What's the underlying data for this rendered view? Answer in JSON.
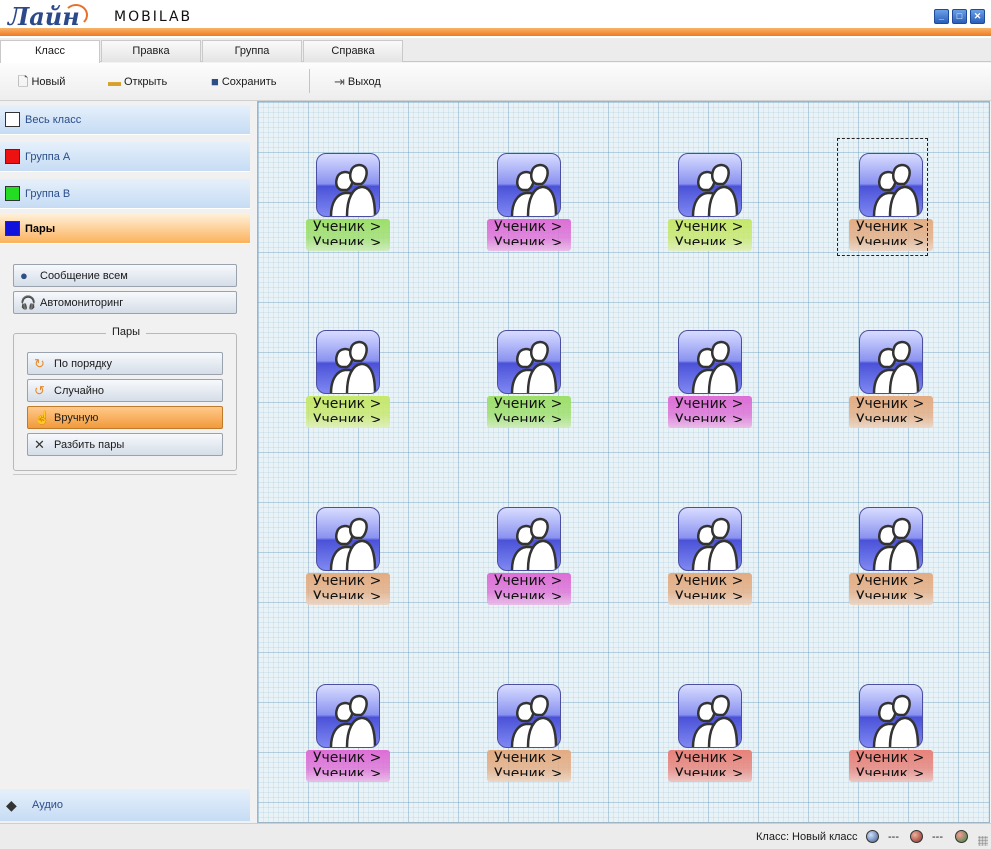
{
  "app": {
    "logo_text": "Лайн",
    "brand": "MOBILAB",
    "window_buttons": [
      "minimize-icon",
      "maximize-icon",
      "close-icon"
    ]
  },
  "tabs": [
    {
      "label": "Класс",
      "active": true
    },
    {
      "label": "Правка",
      "active": false
    },
    {
      "label": "Группа",
      "active": false
    },
    {
      "label": "Справка",
      "active": false
    }
  ],
  "toolbar": {
    "new_label": "Новый",
    "open_label": "Открыть",
    "save_label": "Сохранить",
    "exit_label": "Выход"
  },
  "sidebar": {
    "groups": [
      {
        "label": "Весь класс",
        "color": "#ffffff",
        "active": false
      },
      {
        "label": "Группа A",
        "color": "#ee1111",
        "active": false
      },
      {
        "label": "Группа B",
        "color": "#22dd22",
        "active": false
      },
      {
        "label": "Пары",
        "color": "#1111dd",
        "active": true
      }
    ],
    "message_all": "Сообщение всем",
    "automonitoring": "Автомониторинг",
    "pairs": {
      "legend": "Пары",
      "in_order": "По порядку",
      "random": "Случайно",
      "manual": "Вручную",
      "split": "Разбить пары"
    },
    "audio": "Аудио"
  },
  "students": {
    "line1": "Ученик >",
    "line2": "Ученик >",
    "label_colors": {
      "green": "#9ddf6a",
      "magenta": "#dd6ed6",
      "lime": "#c6e86a",
      "peach": "#e3ac82",
      "salmon": "#e7827a"
    },
    "grid": [
      [
        "green",
        "magenta",
        "lime",
        "peach"
      ],
      [
        "lime",
        "green",
        "magenta",
        "peach"
      ],
      [
        "peach",
        "magenta",
        "peach",
        "peach"
      ],
      [
        "magenta",
        "peach",
        "salmon",
        "salmon"
      ]
    ],
    "selected": [
      0,
      3
    ]
  },
  "status": {
    "class_text": "Класс: Новый класс",
    "indicator1": "---",
    "indicator2": "---",
    "led_colors": [
      "#3a5a8c",
      "#8a2a1e",
      "#2a8a3a"
    ]
  }
}
